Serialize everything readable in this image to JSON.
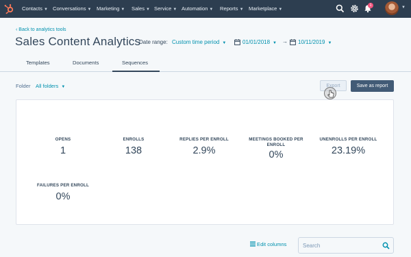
{
  "nav": {
    "items": [
      {
        "label": "Contacts"
      },
      {
        "label": "Conversations"
      },
      {
        "label": "Marketing"
      },
      {
        "label": "Sales"
      },
      {
        "label": "Service"
      },
      {
        "label": "Automation"
      },
      {
        "label": "Reports"
      },
      {
        "label": "Marketplace"
      }
    ],
    "notification_count": "1",
    "logo_color": "#ff7a59",
    "bar_color": "#2d3e50"
  },
  "header": {
    "back_link": "Back to analytics tools",
    "title": "Sales Content Analytics",
    "date_range_label": "Date range:",
    "date_range_value": "Custom time period",
    "start_date": "01/01/2018",
    "end_date": "10/11/2019"
  },
  "tabs": [
    {
      "label": "Templates"
    },
    {
      "label": "Documents"
    },
    {
      "label": "Sequences",
      "active": true
    }
  ],
  "filters": {
    "folder_label": "Folder",
    "folder_value": "All folders",
    "export_label": "Export",
    "save_label": "Save as report"
  },
  "stats": [
    {
      "label": "OPENS",
      "value": "1"
    },
    {
      "label": "ENROLLS",
      "value": "138"
    },
    {
      "label": "REPLIES PER ENROLL",
      "value": "2.9%"
    },
    {
      "label": "MEETINGS BOOKED PER ENROLL",
      "value": "0%"
    },
    {
      "label": "UNENROLLS PER ENROLL",
      "value": "23.19%"
    },
    {
      "label": "FAILURES PER ENROLL",
      "value": "0%"
    }
  ],
  "table_tools": {
    "edit_columns": "Edit columns",
    "search_placeholder": "Search"
  },
  "colors": {
    "accent": "#0091ae",
    "primary_button": "#425b76",
    "notification": "#f2547d"
  }
}
